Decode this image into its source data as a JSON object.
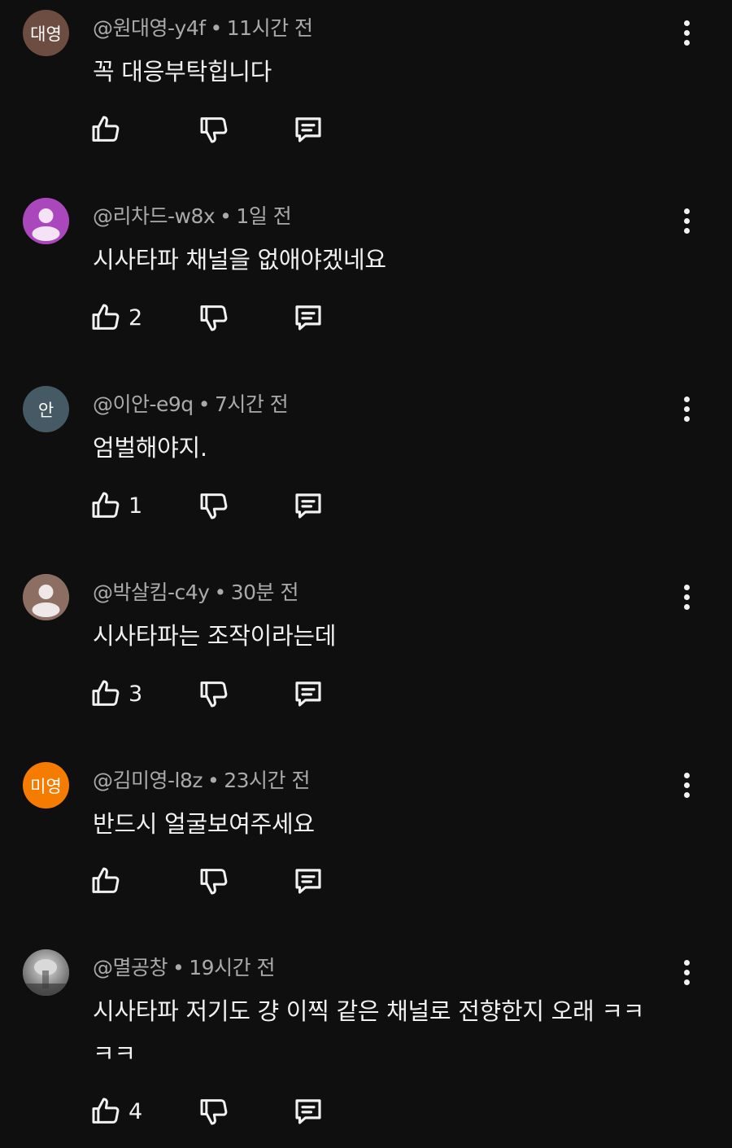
{
  "comments": [
    {
      "author": "@원대영-y4f",
      "time": "11시간 전",
      "text": "꼭 대응부탁힙니다",
      "likes": "",
      "avatar": {
        "type": "initials",
        "text": "대영",
        "color": "#6d4c41"
      }
    },
    {
      "author": "@리차드-w8x",
      "time": "1일 전",
      "text": "시사타파 채널을 없애야겠네요",
      "likes": "2",
      "avatar": {
        "type": "person",
        "color": "#ab47bc"
      }
    },
    {
      "author": "@이안-e9q",
      "time": "7시간 전",
      "text": "엄벌해야지.",
      "likes": "1",
      "avatar": {
        "type": "initials",
        "text": "안",
        "color": "#455a64"
      }
    },
    {
      "author": "@박살킴-c4y",
      "time": "30분 전",
      "text": "시사타파는 조작이라는데",
      "likes": "3",
      "avatar": {
        "type": "person",
        "color": "#8d6e63"
      }
    },
    {
      "author": "@김미영-l8z",
      "time": "23시간 전",
      "text": "반드시 얼굴보여주세요",
      "likes": "",
      "avatar": {
        "type": "initials",
        "text": "미영",
        "color": "#f57c00"
      }
    },
    {
      "author": "@멸공창",
      "time": "19시간 전",
      "text": "시사타파 저기도 걍 이찍 같은 채널로 전향한지 오래 ㅋㅋ\nㅋㅋ",
      "likes": "4",
      "avatar": {
        "type": "photo",
        "color": "#9e9e9e"
      }
    }
  ],
  "icons": {
    "like": "thumbs-up-icon",
    "dislike": "thumbs-down-icon",
    "reply": "reply-icon",
    "more": "more-vert-icon"
  },
  "colors": {
    "background": "#0f0f0f",
    "text": "#f1f1f1",
    "meta": "#aaaaaa"
  }
}
